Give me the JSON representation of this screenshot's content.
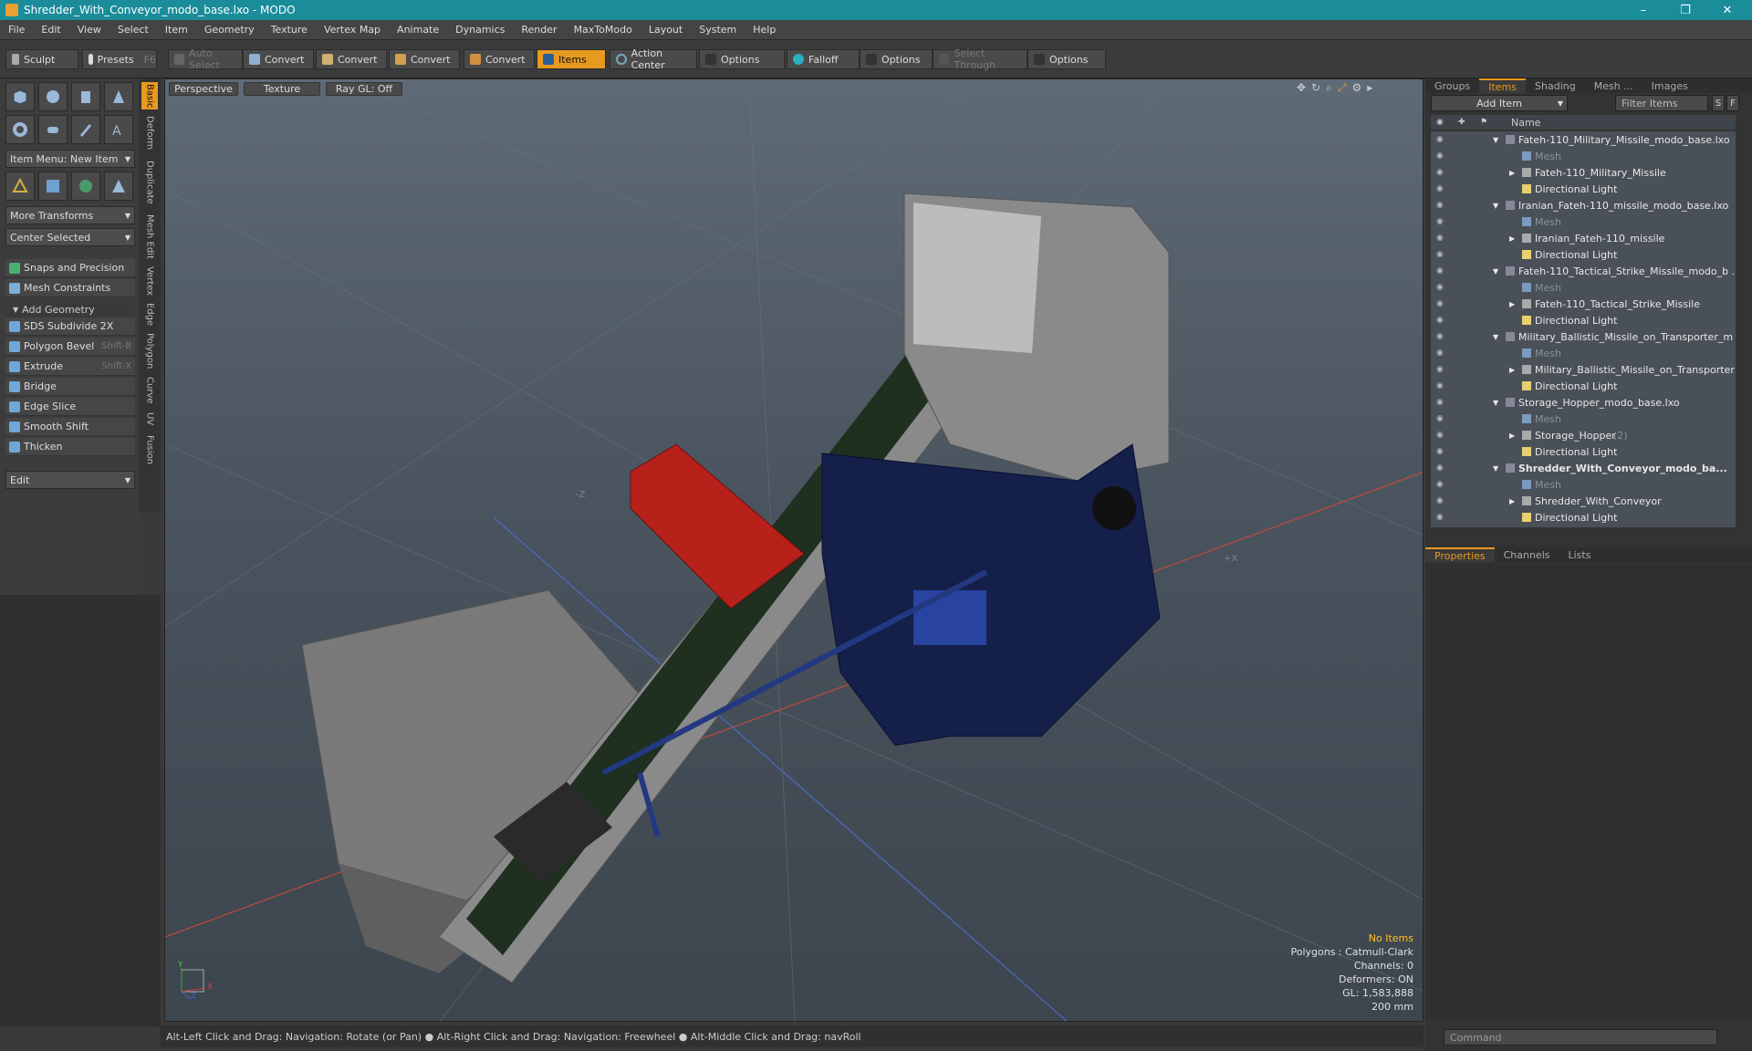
{
  "window": {
    "title": "Shredder_With_Conveyor_modo_base.lxo - MODO",
    "minimize": "–",
    "maximize": "❐",
    "close": "✕"
  },
  "menu": [
    "File",
    "Edit",
    "View",
    "Select",
    "Item",
    "Geometry",
    "Texture",
    "Vertex Map",
    "Animate",
    "Dynamics",
    "Render",
    "MaxToModo",
    "Layout",
    "System",
    "Help"
  ],
  "toolbar": {
    "sculpt": "Sculpt",
    "presets": "Presets",
    "presets_key": "F6",
    "auto_select": "Auto Select",
    "convert1": "Convert",
    "convert2": "Convert",
    "convert3": "Convert",
    "convert4": "Convert",
    "items": "Items",
    "action_center": "Action Center",
    "options1": "Options",
    "falloff": "Falloff",
    "options2": "Options",
    "select_through": "Select Through",
    "options3": "Options"
  },
  "left": {
    "item_menu": "Item Menu: New Item",
    "more_transforms": "More Transforms",
    "center_selected": "Center Selected",
    "snaps": "Snaps and Precision",
    "mesh_constraints": "Mesh Constraints",
    "add_geometry": "Add Geometry",
    "tools": [
      {
        "label": "SDS Subdivide 2X",
        "key": ""
      },
      {
        "label": "Polygon Bevel",
        "key": "Shift-B"
      },
      {
        "label": "Extrude",
        "key": "Shift-X"
      },
      {
        "label": "Bridge",
        "key": ""
      },
      {
        "label": "Edge Slice",
        "key": ""
      },
      {
        "label": "Smooth Shift",
        "key": ""
      },
      {
        "label": "Thicken",
        "key": ""
      }
    ],
    "edit": "Edit",
    "vtabs": [
      "Basic",
      "Deform",
      "Duplicate",
      "Mesh Edit",
      "Vertex",
      "Edge",
      "Polygon",
      "Curve",
      "UV",
      "Fusion"
    ]
  },
  "viewport": {
    "perspective": "Perspective",
    "texture": "Texture",
    "raygl": "Ray GL: Off",
    "no_items": "No Items",
    "polygons": "Polygons : Catmull-Clark",
    "channels": "Channels: 0",
    "deformers": "Deformers: ON",
    "gl": "GL: 1,583,888",
    "scale": "200 mm",
    "axis_x": "X",
    "axis_y": "Y",
    "axis_z": "Z",
    "grid_z": "-Z",
    "grid_x": "+X"
  },
  "statusbar": "Alt-Left Click and Drag: Navigation: Rotate (or Pan) ● Alt-Right Click and Drag: Navigation: Freewheel ● Alt-Middle Click and Drag: navRoll",
  "right": {
    "tabs": [
      "Groups",
      "Items",
      "Shading",
      "Mesh ...",
      "Images"
    ],
    "add_item": "Add Item",
    "filter_items": "Filter Items",
    "filter_s": "S",
    "filter_f": "F",
    "name_header": "Name",
    "items": [
      {
        "label": "Fateh-110_Military_Missile_modo_base.lxo",
        "level": 0,
        "kind": "scene"
      },
      {
        "label": "Mesh",
        "level": 1,
        "kind": "mesh"
      },
      {
        "label": "Fateh-110_Military_Missile",
        "level": 1,
        "kind": "group"
      },
      {
        "label": "Directional Light",
        "level": 1,
        "kind": "light"
      },
      {
        "label": "Iranian_Fateh-110_missile_modo_base.lxo",
        "level": 0,
        "kind": "scene"
      },
      {
        "label": "Mesh",
        "level": 1,
        "kind": "mesh"
      },
      {
        "label": "Iranian_Fateh-110_missile",
        "level": 1,
        "kind": "group"
      },
      {
        "label": "Directional Light",
        "level": 1,
        "kind": "light"
      },
      {
        "label": "Fateh-110_Tactical_Strike_Missile_modo_b ...",
        "level": 0,
        "kind": "scene"
      },
      {
        "label": "Mesh",
        "level": 1,
        "kind": "mesh"
      },
      {
        "label": "Fateh-110_Tactical_Strike_Missile",
        "level": 1,
        "kind": "group"
      },
      {
        "label": "Directional Light",
        "level": 1,
        "kind": "light"
      },
      {
        "label": "Military_Ballistic_Missile_on_Transporter_m ...",
        "level": 0,
        "kind": "scene"
      },
      {
        "label": "Mesh",
        "level": 1,
        "kind": "mesh"
      },
      {
        "label": "Military_Ballistic_Missile_on_Transporter",
        "level": 1,
        "kind": "group"
      },
      {
        "label": "Directional Light",
        "level": 1,
        "kind": "light"
      },
      {
        "label": "Storage_Hopper_modo_base.lxo",
        "level": 0,
        "kind": "scene"
      },
      {
        "label": "Mesh",
        "level": 1,
        "kind": "mesh"
      },
      {
        "label": "Storage_Hopper",
        "level": 1,
        "kind": "group",
        "suffix": "(2)"
      },
      {
        "label": "Directional Light",
        "level": 1,
        "kind": "light"
      },
      {
        "label": "Shredder_With_Conveyor_modo_ba...",
        "level": 0,
        "kind": "scene",
        "bold": true
      },
      {
        "label": "Mesh",
        "level": 1,
        "kind": "mesh"
      },
      {
        "label": "Shredder_With_Conveyor",
        "level": 1,
        "kind": "group"
      },
      {
        "label": "Directional Light",
        "level": 1,
        "kind": "light"
      }
    ],
    "prop_tabs": [
      "Properties",
      "Channels",
      "Lists"
    ],
    "command": "Command"
  },
  "colors": {
    "accent": "#e89a20",
    "titlebar": "#1a8c9a"
  }
}
